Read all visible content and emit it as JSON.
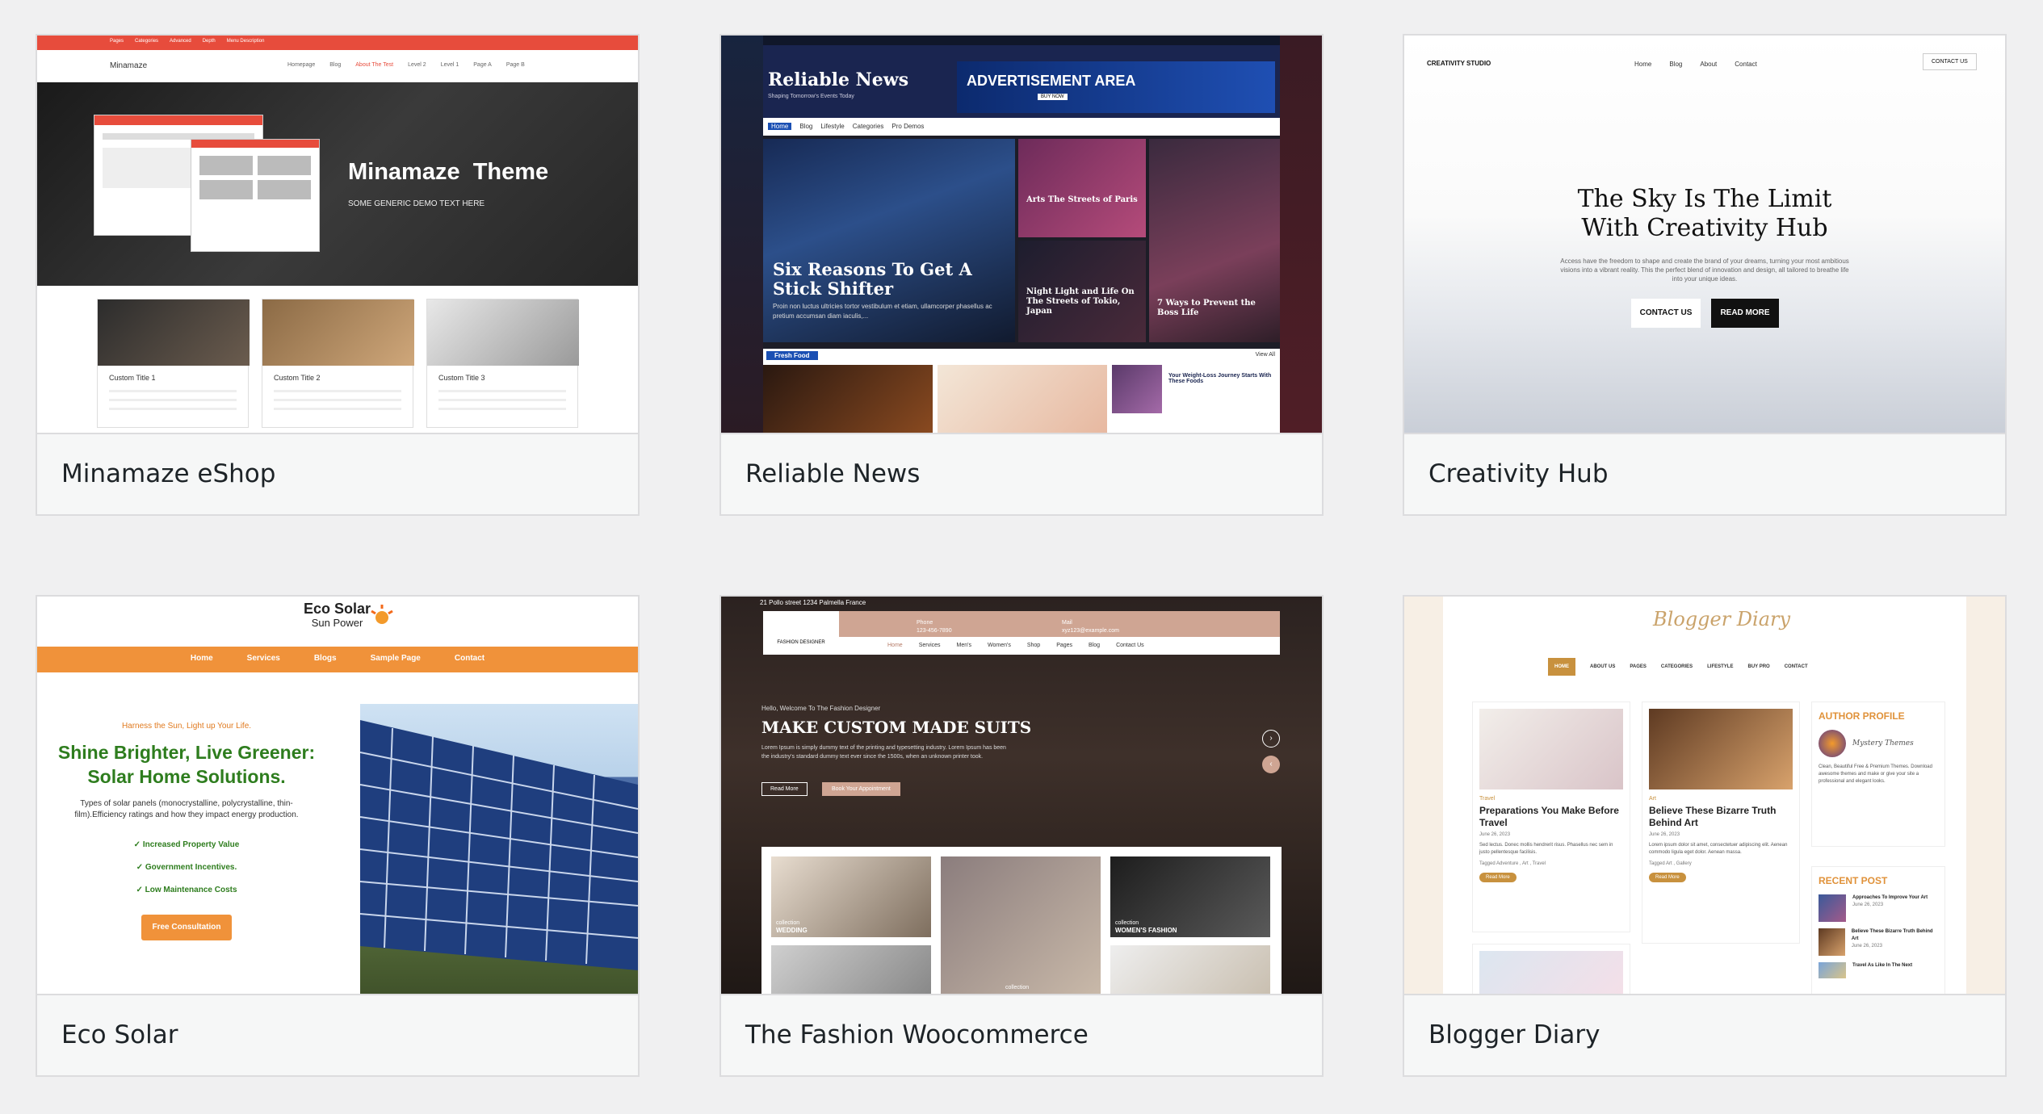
{
  "cards": [
    {
      "title": "Minamaze eShop",
      "preview": {
        "nav_top": [
          "Pages",
          "Categories",
          "Advanced",
          "Depth",
          "Menu Description"
        ],
        "logo": "Minamaze",
        "nav": [
          "Homepage",
          "Blog",
          "About The Test",
          "Level 2",
          "Level 1",
          "Page A",
          "Page B"
        ],
        "hero_title": "Minamaze  Theme",
        "hero_subtitle": "SOME GENERIC DEMO TEXT HERE",
        "items": [
          {
            "title": "Custom Title 1"
          },
          {
            "title": "Custom Title 2"
          },
          {
            "title": "Custom Title 3"
          }
        ]
      }
    },
    {
      "title": "Reliable News",
      "preview": {
        "logo": "Reliable News",
        "tagline": "Shaping Tomorrow's Events Today",
        "ad_text": "ADVERTISEMENT AREA",
        "ad_button": "BUY NOW",
        "nav": [
          "Home",
          "Blog",
          "Lifestyle",
          "Categories",
          "Pro Demos"
        ],
        "main_headline": "Six Reasons To Get A Stick Shifter",
        "main_excerpt": "Proin non luctus ultricies tortor vestibulum et etiam, ullamcorper phasellus ac pretium accumsan diam iaculis,...",
        "side_1": "Arts The Streets of Paris",
        "side_2": "Night Light and Life On The Streets of Tokio, Japan",
        "side_3": "7 Ways to Prevent the Boss Life",
        "section_label": "Fresh Food",
        "view_all": "View All",
        "list_item": "Your Weight-Loss Journey Starts With These Foods"
      }
    },
    {
      "title": "Creativity Hub",
      "preview": {
        "logo": "CREATIVITY STUDIO",
        "nav": [
          "Home",
          "Blog",
          "About",
          "Contact"
        ],
        "contact_button": "CONTACT US",
        "hero_line1": "The Sky Is The Limit",
        "hero_line2": "With Creativity Hub",
        "hero_text": "Access have the freedom to shape and create the brand of your dreams, turning your most ambitious visions into a vibrant reality. This the perfect blend of innovation and design, all tailored to breathe life into your unique ideas.",
        "button_1": "CONTACT US",
        "button_2": "READ MORE"
      }
    },
    {
      "title": "Eco Solar",
      "preview": {
        "logo_line1": "Eco Solar",
        "logo_line2": "Sun Power",
        "nav": [
          "Home",
          "Services",
          "Blogs",
          "Sample Page",
          "Contact"
        ],
        "kicker": "Harness the Sun, Light up Your Life.",
        "headline_1": "Shine Brighter, Live Greener:",
        "headline_2": "Solar Home Solutions.",
        "body": "Types of solar panels (monocrystalline, polycrystalline, thin-film).Efficiency ratings and how they impact energy production.",
        "benefits": [
          "✓ Increased Property Value",
          "✓ Government Incentives.",
          "✓ Low Maintenance Costs"
        ],
        "cta": "Free Consultation"
      }
    },
    {
      "title": "The Fashion Woocommerce",
      "preview": {
        "address": "21 Pollo street 1234 Palmella France",
        "phone_label": "Phone",
        "phone": "123-456-7890",
        "mail_label": "Mail",
        "mail": "xyz123@example.com",
        "logo": "FASHION DESIGNER",
        "nav": [
          "Home",
          "Services",
          "Men's",
          "Women's",
          "Shop",
          "Pages",
          "Blog",
          "Contact Us"
        ],
        "welcome": "Hello, Welcome To The Fashion Designer",
        "headline": "MAKE CUSTOM MADE SUITS",
        "body": "Lorem Ipsum is simply dummy text of the printing and typesetting industry. Lorem Ipsum has been the industry's standard dummy text ever since the 1500s, when an unknown printer took.",
        "button_1": "Read More",
        "button_2": "Book Your Appointment",
        "collections": [
          {
            "tag": "collection",
            "name": "WEDDING"
          },
          {
            "tag": "collection",
            "name": ""
          },
          {
            "tag": "collection",
            "name": "WOMEN'S FASHION"
          }
        ]
      }
    },
    {
      "title": "Blogger Diary",
      "preview": {
        "logo": "Blogger Diary",
        "nav": [
          "HOME",
          "ABOUT US",
          "PAGES",
          "CATEGORIES",
          "LIFESTYLE",
          "BUY PRO",
          "CONTACT"
        ],
        "posts": [
          {
            "category": "Travel",
            "title": "Preparations You Make Before Travel",
            "date": "June 26, 2023",
            "excerpt": "Sed lectus. Donec mollis hendrerit risus. Phasellus nec sem in justo pellentesque facilisis.",
            "tags": "Tagged Adventure , Art , Travel",
            "button": "Read More"
          },
          {
            "category": "Art",
            "title": "Believe These Bizarre Truth Behind Art",
            "date": "June 26, 2023",
            "excerpt": "Lorem ipsum dolor sit amet, consectetuer adipiscing elit. Aenean commodo ligula eget dolor. Aenean massa.",
            "tags": "Tagged Art , Gallery",
            "button": "Read More"
          }
        ],
        "author_heading": "AUTHOR PROFILE",
        "author_name": "Mystery Themes",
        "author_bio": "Clean, Beautiful Free & Premium Themes. Download awesome themes and make or give your site a professional and elegant looks.",
        "recent_heading": "RECENT POST",
        "recent": [
          {
            "title": "Approaches To Improve Your Art",
            "date": "June 26, 2023"
          },
          {
            "title": "Believe These Bizarre Truth Behind Art",
            "date": "June 26, 2023"
          },
          {
            "title": "Travel As Like In The Next",
            "date": ""
          }
        ]
      }
    }
  ]
}
